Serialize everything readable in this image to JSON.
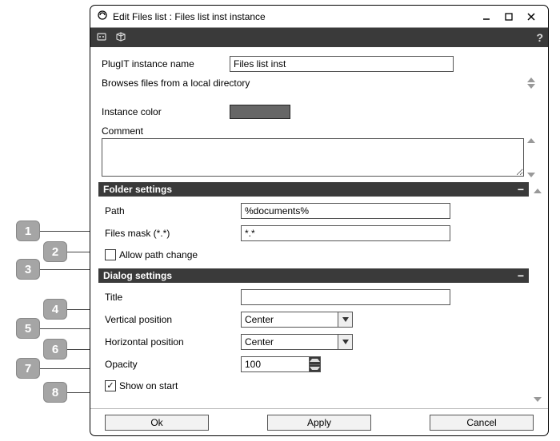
{
  "window": {
    "title": "Edit Files list : Files list inst instance"
  },
  "upper": {
    "plugit_label": "PlugIT instance name",
    "plugit_value": "Files list inst",
    "description": "Browses files from a local directory",
    "instance_color_label": "Instance color",
    "comment_label": "Comment",
    "comment_value": ""
  },
  "folder": {
    "header": "Folder settings",
    "path_label": "Path",
    "path_value": "%documents%",
    "mask_label": "Files mask (*.*)",
    "mask_value": "*.*",
    "allow_path_label": "Allow path change",
    "allow_path_checked": false
  },
  "dialog": {
    "header": "Dialog settings",
    "title_label": "Title",
    "title_value": "",
    "vpos_label": "Vertical position",
    "vpos_value": "Center",
    "hpos_label": "Horizontal position",
    "hpos_value": "Center",
    "opacity_label": "Opacity",
    "opacity_value": "100",
    "show_on_start_label": "Show on start",
    "show_on_start_checked": true
  },
  "buttons": {
    "ok": "Ok",
    "apply": "Apply",
    "cancel": "Cancel"
  },
  "callouts": [
    "1",
    "2",
    "3",
    "4",
    "5",
    "6",
    "7",
    "8"
  ]
}
